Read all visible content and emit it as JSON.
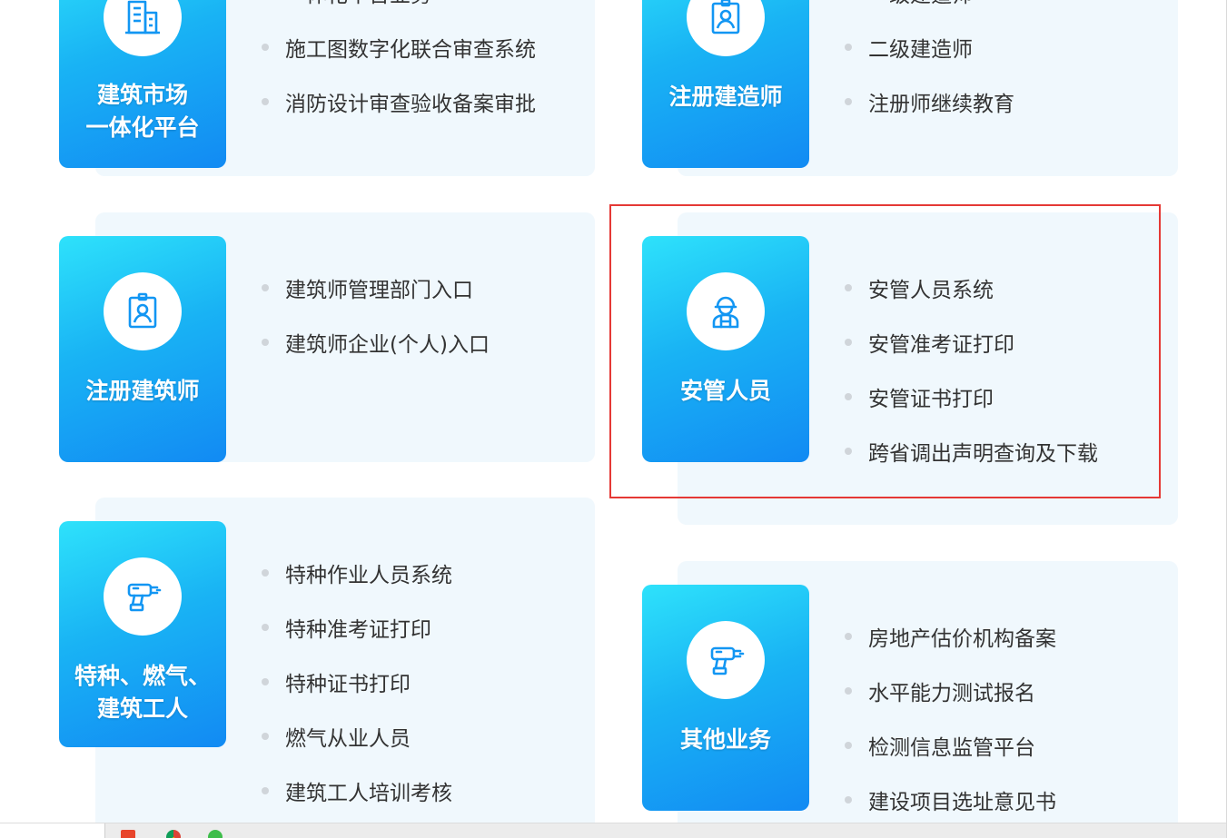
{
  "colors": {
    "tile_gradient_start": "#2ee2fb",
    "tile_gradient_end": "#128af3",
    "card_background": "#f0f8fd",
    "icon_stroke": "#1296f3",
    "highlight_border": "#e53935",
    "link_text": "#333333",
    "bullet": "#d0d5da"
  },
  "sections": [
    {
      "title": "建筑市场\n一体化平台",
      "icon": "building-icon",
      "links": [
        "一体化平台业务",
        "施工图数字化联合审查系统",
        "消防设计审查验收备案审批"
      ]
    },
    {
      "title": "注册建造师",
      "icon": "id-badge-icon",
      "links": [
        "一级建造师",
        "二级建造师",
        "注册师继续教育"
      ]
    },
    {
      "title": "注册建筑师",
      "icon": "id-badge-icon",
      "links": [
        "建筑师管理部门入口",
        "建筑师企业(个人)入口"
      ]
    },
    {
      "title": "安管人员",
      "icon": "worker-icon",
      "links": [
        "安管人员系统",
        "安管准考证打印",
        "安管证书打印",
        "跨省调出声明查询及下载"
      ]
    },
    {
      "title": "特种、燃气、\n建筑工人",
      "icon": "drill-icon",
      "links": [
        "特种作业人员系统",
        "特种准考证打印",
        "特种证书打印",
        "燃气从业人员",
        "建筑工人培训考核"
      ]
    },
    {
      "title": "其他业务",
      "icon": "drill-icon",
      "links": [
        "房地产估价机构备案",
        "水平能力测试报名",
        "检测信息监管平台",
        "建设项目选址意见书"
      ]
    }
  ],
  "taskbar": {
    "icons": [
      "app-icon-red",
      "chrome-icon",
      "wechat-icon"
    ]
  }
}
